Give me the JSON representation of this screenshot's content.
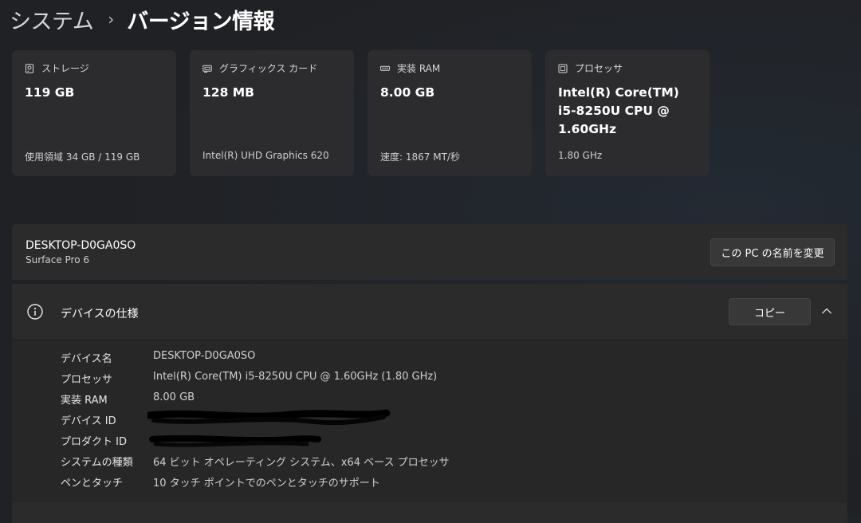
{
  "breadcrumb": {
    "parent": "システム",
    "separator": "›",
    "title": "バージョン情報"
  },
  "cards": [
    {
      "icon": "storage-icon",
      "label": "ストレージ",
      "value": "119 GB",
      "sub": "使用領域 34 GB / 119 GB"
    },
    {
      "icon": "graphics-card-icon",
      "label": "グラフィックス カード",
      "value": "128 MB",
      "sub": "Intel(R) UHD Graphics 620"
    },
    {
      "icon": "ram-icon",
      "label": "実装 RAM",
      "value": "8.00 GB",
      "sub": "速度: 1867 MT/秒"
    },
    {
      "icon": "processor-icon",
      "label": "プロセッサ",
      "value": "Intel(R) Core(TM) i5-8250U CPU @ 1.60GHz",
      "sub": "1.80 GHz"
    }
  ],
  "device": {
    "name": "DESKTOP-D0GA0SO",
    "model": "Surface Pro 6",
    "rename_label": "この PC の名前を変更"
  },
  "specs": {
    "icon": "info-icon",
    "title": "デバイスの仕様",
    "copy_label": "コピー",
    "rows": [
      {
        "key": "デバイス名",
        "value": "DESKTOP-D0GA0SO"
      },
      {
        "key": "プロセッサ",
        "value": "Intel(R) Core(TM) i5-8250U CPU @ 1.60GHz (1.80 GHz)"
      },
      {
        "key": "実装 RAM",
        "value": "8.00 GB"
      },
      {
        "key": "デバイス ID",
        "value": ""
      },
      {
        "key": "プロダクト ID",
        "value": ""
      },
      {
        "key": "システムの種類",
        "value": "64 ビット オペレーティング システム、x64 ベース プロセッサ"
      },
      {
        "key": "ペンとタッチ",
        "value": "10 タッチ ポイントでのペンとタッチのサポート"
      }
    ]
  },
  "colors": {
    "background": "#202124",
    "card": "#2c2c2e",
    "panel": "#2b2b2b",
    "button": "#383838"
  }
}
